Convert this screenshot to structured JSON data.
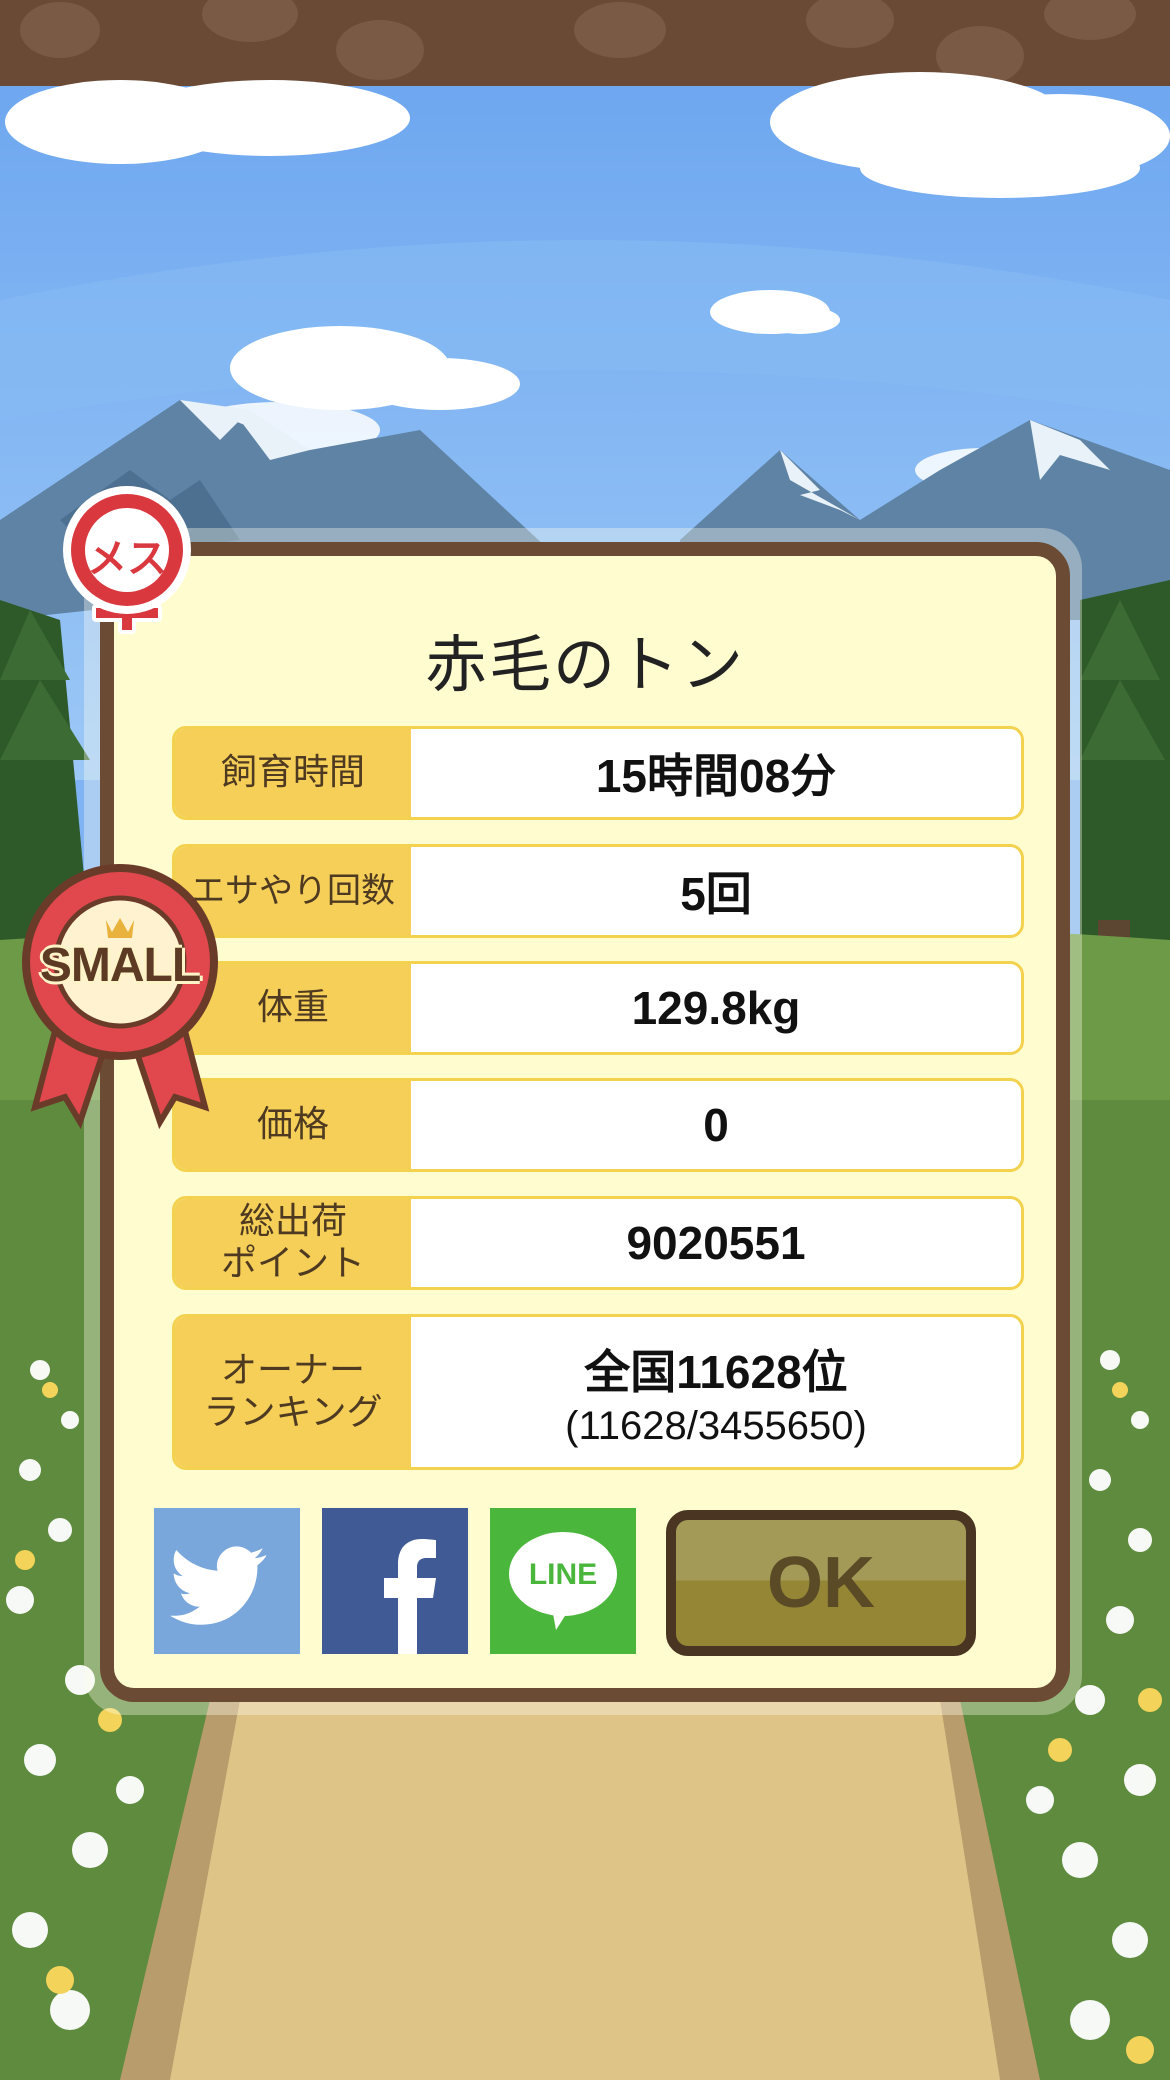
{
  "pig": {
    "name": "赤毛のトン",
    "gender_badge": "メス",
    "size_ribbon": "SMALL"
  },
  "stats": [
    {
      "label": "飼育時間",
      "value": "15時間08分"
    },
    {
      "label": "エサやり回数",
      "value": "5回"
    },
    {
      "label": "体重",
      "value": "129.8kg"
    },
    {
      "label": "価格",
      "value": "0"
    },
    {
      "label": "総出荷\nポイント",
      "value": "9020551"
    },
    {
      "label": "オーナー\nランキング",
      "value": "全国11628位",
      "sub": "(11628/3455650)"
    }
  ],
  "share": {
    "line_label": "LINE",
    "twitter_icon": "twitter-bird-icon",
    "facebook_icon": "facebook-f-icon",
    "line_icon": "line-bubble-icon"
  },
  "ok_label": "OK",
  "colors": {
    "sky": "#7fb3f3",
    "panel": "#fffcd0",
    "frame": "#6b4b34",
    "label_bg": "#f6cf58",
    "twitter": "#7aa7db",
    "facebook": "#3f5a94",
    "line": "#4ab63b",
    "badge_red": "#d9383f"
  }
}
